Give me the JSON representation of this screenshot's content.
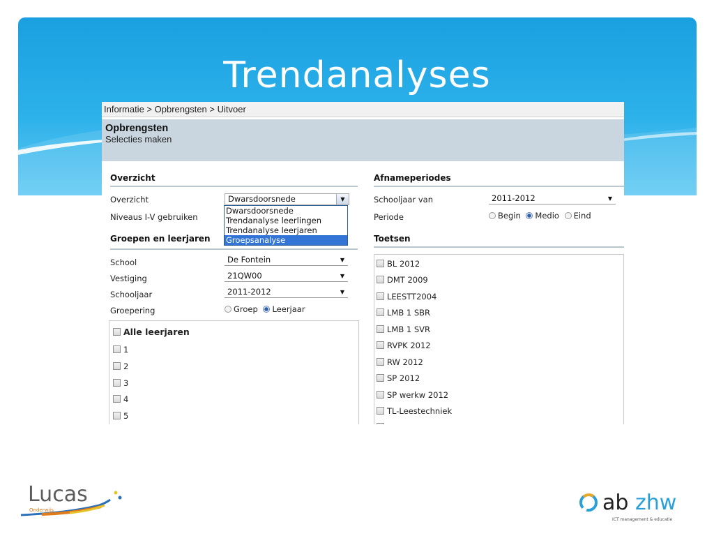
{
  "slide": {
    "title": "Trendanalyses"
  },
  "breadcrumb": "Informatie > Opbrengsten > Uitvoer",
  "page_header": {
    "title": "Opbrengsten",
    "subtitle": "Selecties maken"
  },
  "overzicht": {
    "heading": "Overzicht",
    "overzicht_label": "Overzicht",
    "overzicht_value": "Dwarsdoorsnede",
    "dropdown_options": [
      "Dwarsdoorsnede",
      "Trendanalyse leerlingen",
      "Trendanalyse leerjaren",
      "Groepsanalyse"
    ],
    "highlighted_option": "Groepsanalyse",
    "niveaus_label": "Niveaus I-V gebruiken"
  },
  "groepen": {
    "heading": "Groepen en leerjaren",
    "school_label": "School",
    "school_value": "De Fontein",
    "vestiging_label": "Vestiging",
    "vestiging_value": "21QW00",
    "schooljaar_label": "Schooljaar",
    "schooljaar_value": "2011-2012",
    "groepering_label": "Groepering",
    "groepering_options": [
      "Groep",
      "Leerjaar"
    ],
    "groepering_selected": "Leerjaar",
    "all_label": "Alle leerjaren",
    "leerjaren": [
      "1",
      "2",
      "3",
      "4",
      "5"
    ]
  },
  "afname": {
    "heading": "Afnameperiodes",
    "schooljaar_van_label": "Schooljaar van",
    "schooljaar_van_value": "2011-2012",
    "periode_label": "Periode",
    "periode_options": [
      "Begin",
      "Medio",
      "Eind"
    ],
    "periode_selected": "Medio"
  },
  "toetsen": {
    "heading": "Toetsen",
    "items": [
      "BL 2012",
      "DMT 2009",
      "LEESTT2004",
      "LMB 1 SBR",
      "LMB 1 SVR",
      "RVPK 2012",
      "RW 2012",
      "SP 2012",
      "SP werkw 2012",
      "TL-Leestechniek"
    ]
  },
  "logos": {
    "lucas_name": "Lucas",
    "lucas_sub": "Onderwijs",
    "abzhw_name": "abzhw",
    "abzhw_tagline": "ICT management & educatie"
  },
  "colors": {
    "banner": "#1aa0e0",
    "highlight": "#3375d6",
    "header_band": "#c9d6df"
  }
}
